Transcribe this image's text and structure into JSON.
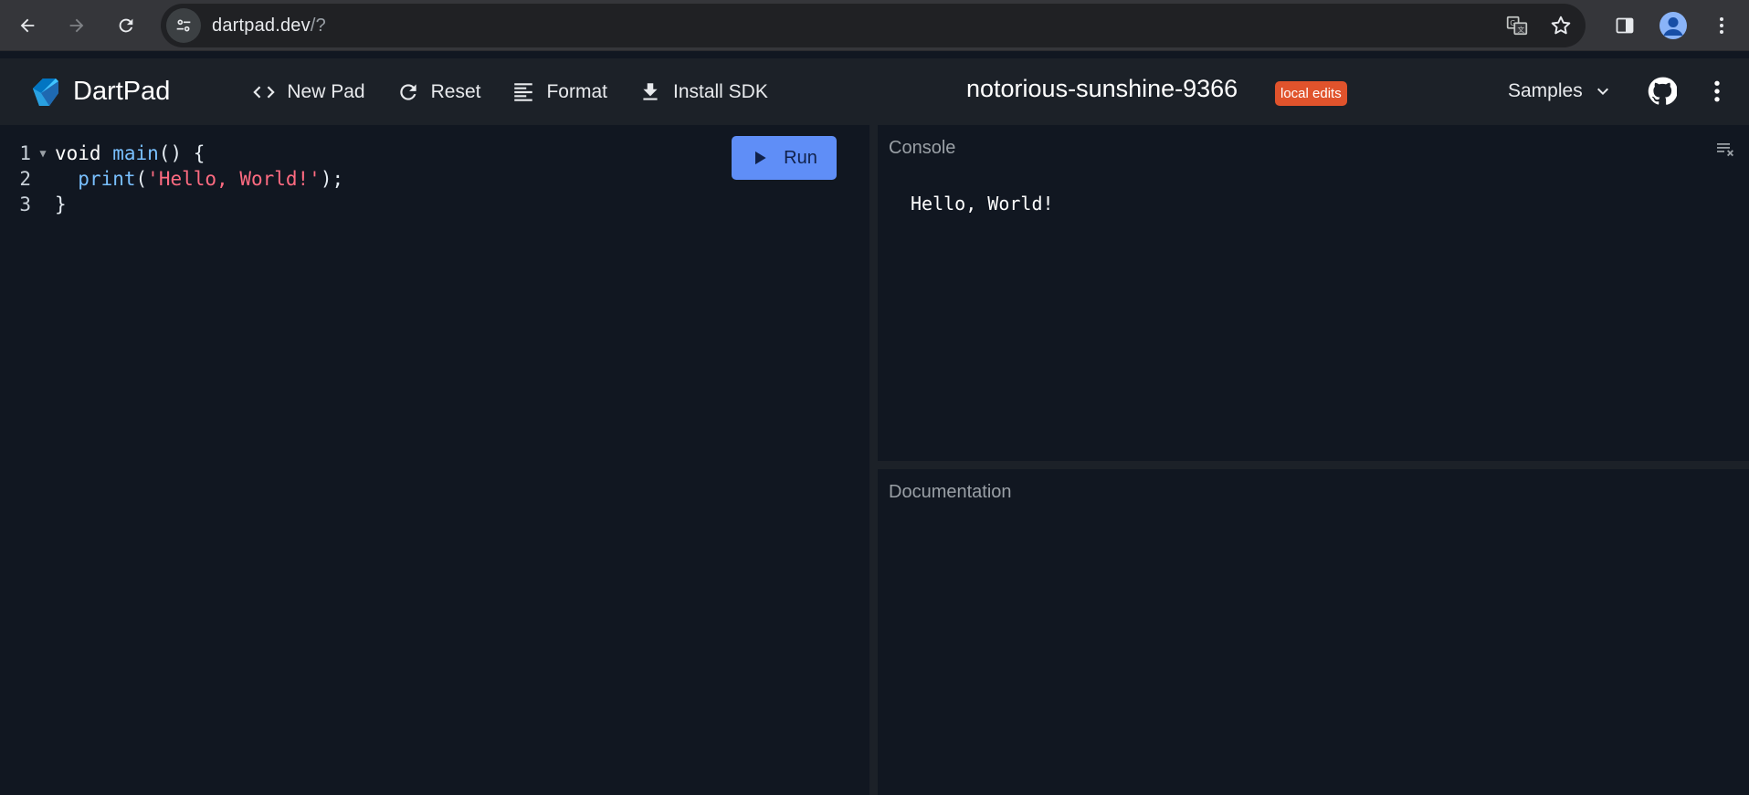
{
  "browser": {
    "url_host": "dartpad.dev",
    "url_path": "/?"
  },
  "app": {
    "name": "DartPad",
    "toolbar": {
      "new_pad": "New Pad",
      "reset": "Reset",
      "format": "Format",
      "install_sdk": "Install SDK"
    },
    "pad_title": "notorious-sunshine-9366",
    "badge": "local edits",
    "samples": "Samples"
  },
  "editor": {
    "run_label": "Run",
    "lines": [
      {
        "no": "1",
        "parts": [
          [
            "kw",
            "void "
          ],
          [
            "fn",
            "main"
          ],
          [
            "pl",
            "() {"
          ]
        ]
      },
      {
        "no": "2",
        "parts": [
          [
            "pl",
            "  "
          ],
          [
            "fn",
            "print"
          ],
          [
            "pl",
            "("
          ],
          [
            "str",
            "'Hello, World!'"
          ],
          [
            "pl",
            ");"
          ]
        ]
      },
      {
        "no": "3",
        "parts": [
          [
            "pl",
            "}"
          ]
        ]
      }
    ]
  },
  "console": {
    "title": "Console",
    "output": "Hello, World!"
  },
  "docs": {
    "title": "Documentation"
  },
  "colors": {
    "run_button": "#5f8ef7",
    "badge": "#e0532c",
    "background": "#111721"
  }
}
